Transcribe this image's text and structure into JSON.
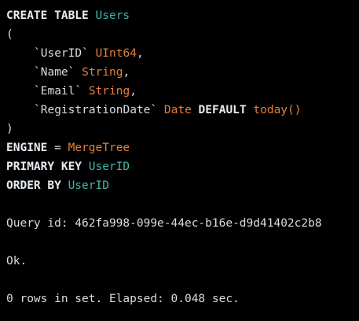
{
  "query": {
    "create_kw": "CREATE TABLE",
    "table_name": "Users",
    "open_paren": "(",
    "columns": [
      {
        "name": "`UserID`",
        "type": "UInt64",
        "suffix": ","
      },
      {
        "name": "`Name`",
        "type": "String",
        "suffix": ","
      },
      {
        "name": "`Email`",
        "type": "String",
        "suffix": ","
      },
      {
        "name": "`RegistrationDate`",
        "type": "Date",
        "default_kw": "DEFAULT",
        "default_value": "today()"
      }
    ],
    "close_paren": ")",
    "engine_kw": "ENGINE",
    "engine_eq": "=",
    "engine_value": "MergeTree",
    "primary_key_kw": "PRIMARY KEY",
    "primary_key_value": "UserID",
    "order_by_kw": "ORDER BY",
    "order_by_value": "UserID"
  },
  "output": {
    "query_id": "Query id: 462fa998-099e-44ec-b16e-d9d41402c2b8",
    "status": "Ok.",
    "summary": "0 rows in set. Elapsed: 0.048 sec."
  },
  "colors": {
    "background": "#000000",
    "identifier": "#3fb8a9",
    "type": "#e57f3a",
    "text": "#d6dde3"
  }
}
